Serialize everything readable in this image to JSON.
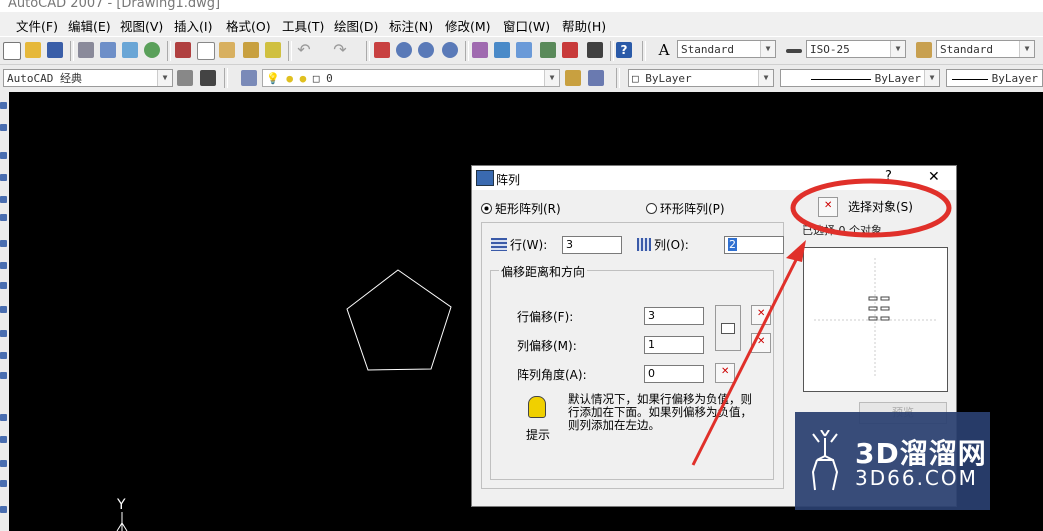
{
  "window": {
    "title": "AutoCAD 2007 - [Drawing1.dwg]"
  },
  "menu": [
    "文件(F)",
    "编辑(E)",
    "视图(V)",
    "插入(I)",
    "格式(O)",
    "工具(T)",
    "绘图(D)",
    "标注(N)",
    "修改(M)",
    "窗口(W)",
    "帮助(H)"
  ],
  "toolbar": {
    "text_style": "Standard",
    "dim_style": "ISO-25",
    "table_style": "Standard",
    "workspace": "AutoCAD 经典",
    "layer": "0",
    "color": "ByLayer",
    "linetype": "ByLayer",
    "lineweight": "ByLayer"
  },
  "canvas": {
    "ucs_y_label": "Y"
  },
  "dialog": {
    "title": "阵列",
    "help": "?",
    "close": "✕",
    "rect_array_label": "矩形阵列(R)",
    "polar_array_label": "环形阵列(P)",
    "selected_mode": "rect",
    "rows_label": "行(W):",
    "rows_value": "3",
    "cols_label": "列(O):",
    "cols_value": "2",
    "offset_group_label": "偏移距离和方向",
    "row_offset_label": "行偏移(F):",
    "row_offset_value": "3",
    "col_offset_label": "列偏移(M):",
    "col_offset_value": "1",
    "angle_label": "阵列角度(A):",
    "angle_value": "0",
    "tip_text_1": "默认情况下，如果行偏移为负值，则",
    "tip_text_2": "行添加在下面。如果列偏移为负值，",
    "tip_text_3": "则列添加在左边。",
    "tip_label": "提示",
    "select_objects_label": "选择对象(S)",
    "selected_count_text": "已选择 0 个对象",
    "preview_button_label": "预览"
  },
  "watermark": {
    "brand": "3D溜溜网",
    "site": "3D66.COM"
  },
  "colors": {
    "highlight_circle": "#e0302a",
    "arrow": "#e0302a",
    "canvas": "#000000",
    "dialog_bg": "#f0f0f0"
  }
}
